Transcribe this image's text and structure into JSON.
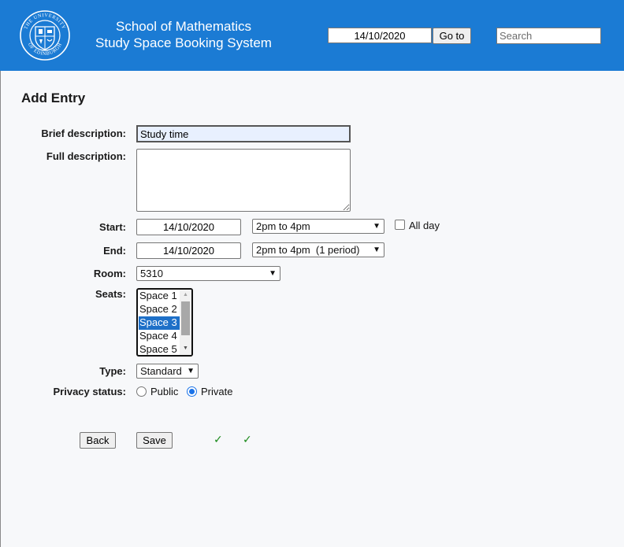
{
  "header": {
    "crest_label": "THE UNIVERSITY OF EDINBURGH",
    "title_line1": "School of Mathematics",
    "title_line2": "Study Space Booking System",
    "date_value": "14/10/2020",
    "goto_label": "Go to",
    "search_placeholder": "Search"
  },
  "form": {
    "title": "Add Entry",
    "brief": {
      "label": "Brief description:",
      "value": "Study time"
    },
    "full": {
      "label": "Full description:",
      "value": ""
    },
    "start": {
      "label": "Start:",
      "date": "14/10/2020",
      "period": "2pm to 4pm",
      "allday_label": "All day",
      "allday_checked": false
    },
    "end": {
      "label": "End:",
      "date": "14/10/2020",
      "period": "2pm to 4pm  (1 period)"
    },
    "room": {
      "label": "Room:",
      "value": "5310"
    },
    "seats": {
      "label": "Seats:",
      "options": [
        "Space 1",
        "Space 2",
        "Space 3",
        "Space 4",
        "Space 5"
      ],
      "selected": "Space 3"
    },
    "type": {
      "label": "Type:",
      "value": "Standard"
    },
    "privacy": {
      "label": "Privacy status:",
      "options": [
        "Public",
        "Private"
      ],
      "selected": "Private"
    }
  },
  "actions": {
    "back_label": "Back",
    "save_label": "Save",
    "tick": "✓"
  },
  "colors": {
    "banner": "#1b7bd4",
    "selected_option": "#1e70c8",
    "tick": "#1a8a1a"
  }
}
